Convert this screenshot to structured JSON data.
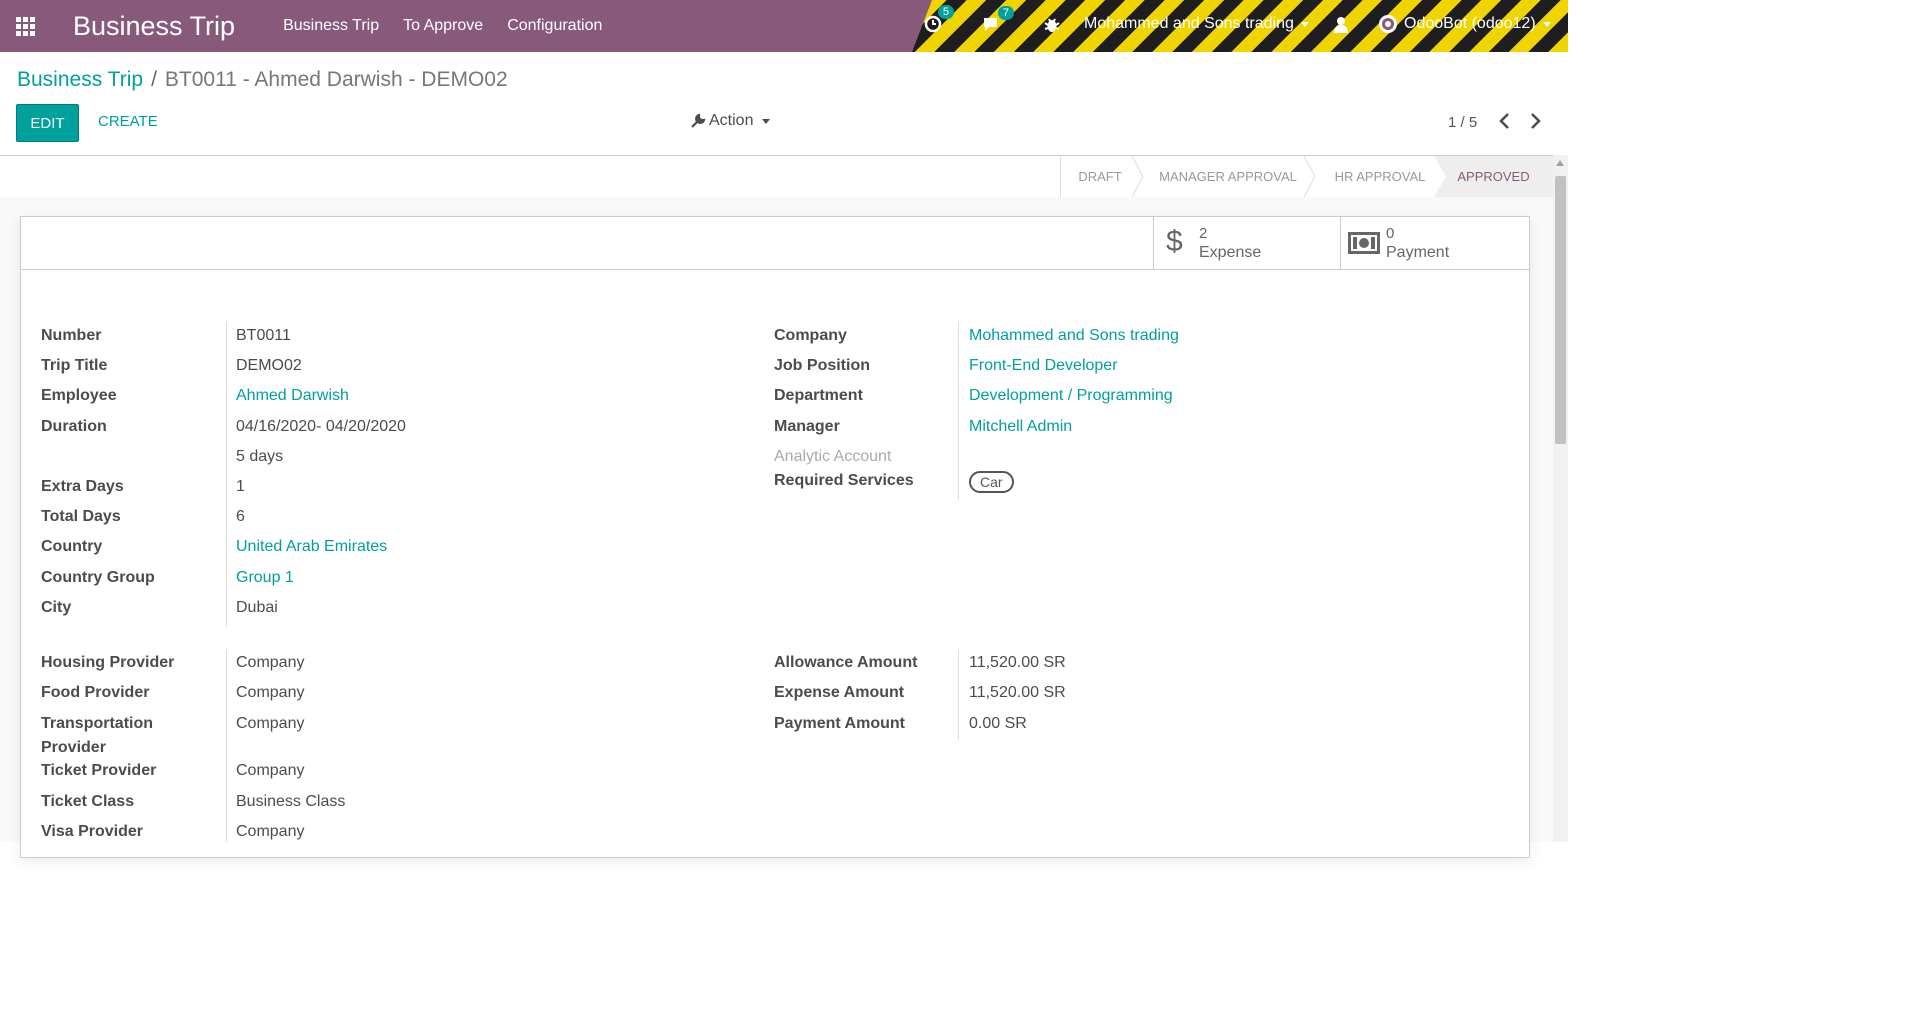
{
  "navbar": {
    "brand": "Business Trip",
    "menu": [
      "Business Trip",
      "To Approve",
      "Configuration"
    ],
    "activity_count": "5",
    "message_count": "7",
    "company": "Mohammed and Sons trading",
    "user": "OdooBot (odoo12)"
  },
  "breadcrumb": {
    "parent": "Business Trip",
    "separator": "/",
    "current": "BT0011 - Ahmed Darwish - DEMO02"
  },
  "buttons": {
    "edit": "EDIT",
    "create": "CREATE",
    "action": "Action"
  },
  "pager": {
    "value": "1 / 5"
  },
  "stages": [
    "DRAFT",
    "MANAGER APPROVAL",
    "HR APPROVAL",
    "APPROVED"
  ],
  "smart_buttons": {
    "expense": {
      "count": "2",
      "label": "Expense"
    },
    "payment": {
      "count": "0",
      "label": "Payment"
    }
  },
  "left_fields": {
    "number": {
      "label": "Number",
      "value": "BT0011"
    },
    "trip_title": {
      "label": "Trip Title",
      "value": "DEMO02"
    },
    "employee": {
      "label": "Employee",
      "value": "Ahmed Darwish"
    },
    "duration": {
      "label": "Duration",
      "value": "04/16/2020- 04/20/2020",
      "days": "5 days"
    },
    "extra_days": {
      "label": "Extra Days",
      "value": "1"
    },
    "total_days": {
      "label": "Total Days",
      "value": "6"
    },
    "country": {
      "label": "Country",
      "value": "United Arab Emirates"
    },
    "country_group": {
      "label": "Country Group",
      "value": "Group 1"
    },
    "city": {
      "label": "City",
      "value": "Dubai"
    }
  },
  "right_fields": {
    "company": {
      "label": "Company",
      "value": "Mohammed and Sons trading"
    },
    "job_position": {
      "label": "Job Position",
      "value": "Front-End Developer"
    },
    "department": {
      "label": "Department",
      "value": "Development / Programming"
    },
    "manager": {
      "label": "Manager",
      "value": "Mitchell Admin"
    },
    "analytic_account": {
      "label": "Analytic Account"
    },
    "required_services": {
      "label": "Required Services",
      "tag": "Car"
    }
  },
  "providers": {
    "housing": {
      "label": "Housing Provider",
      "value": "Company"
    },
    "food": {
      "label": "Food Provider",
      "value": "Company"
    },
    "transportation": {
      "label_line1": "Transportation",
      "label_line2": "Provider",
      "value": "Company"
    },
    "ticket": {
      "label": "Ticket Provider",
      "value": "Company"
    },
    "ticket_class": {
      "label": "Ticket Class",
      "value": "Business Class"
    },
    "visa": {
      "label": "Visa Provider",
      "value": "Company"
    }
  },
  "amounts": {
    "allowance": {
      "label": "Allowance Amount",
      "value": "11,520.00 SR"
    },
    "expense": {
      "label": "Expense Amount",
      "value": "11,520.00 SR"
    },
    "payment": {
      "label": "Payment Amount",
      "value": "0.00 SR"
    }
  }
}
